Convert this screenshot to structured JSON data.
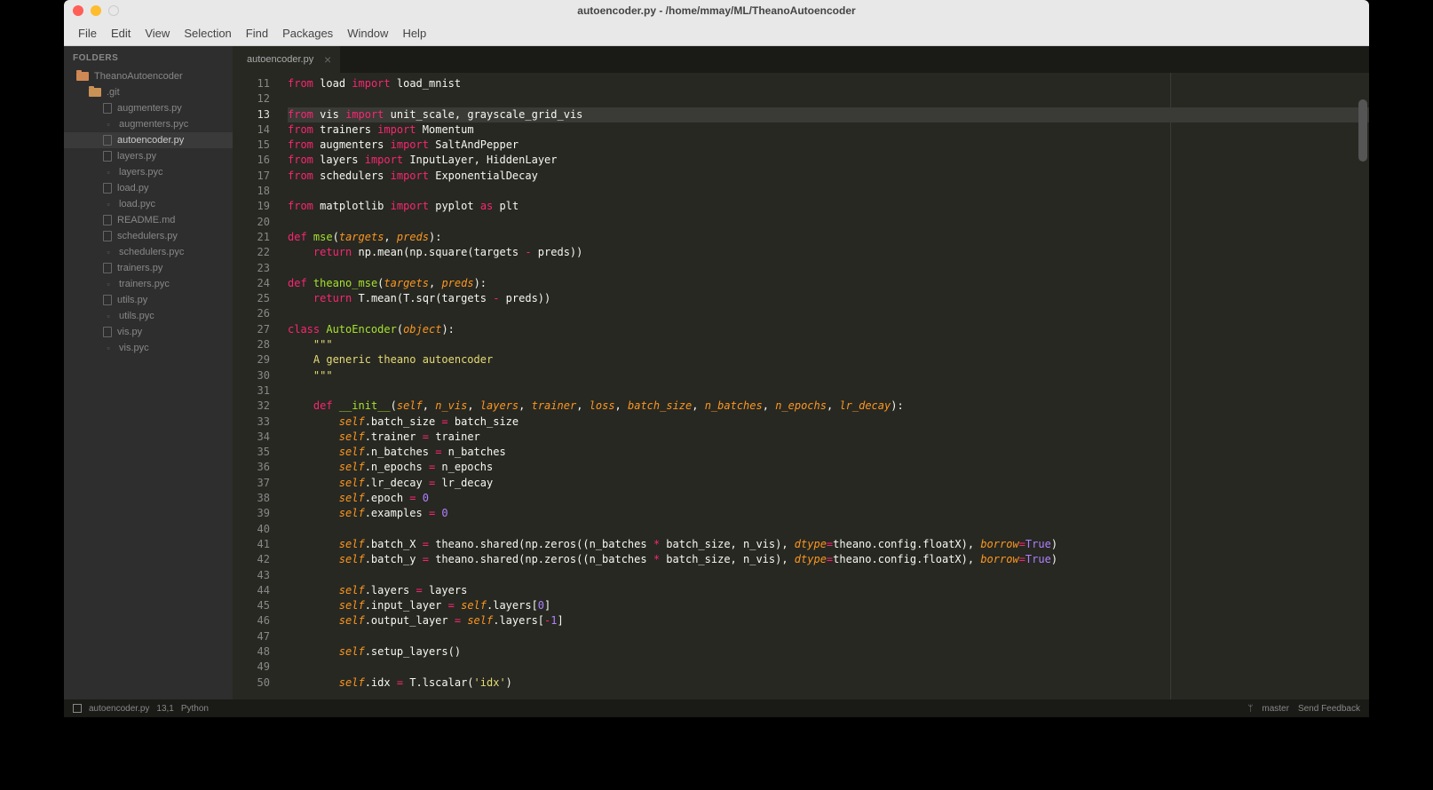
{
  "window": {
    "title": "autoencoder.py - /home/mmay/ML/TheanoAutoencoder"
  },
  "menu": [
    "File",
    "Edit",
    "View",
    "Selection",
    "Find",
    "Packages",
    "Window",
    "Help"
  ],
  "sidebar": {
    "header": "FOLDERS",
    "items": [
      {
        "type": "folder",
        "label": "TheanoAutoencoder",
        "depth": 0,
        "root": true
      },
      {
        "type": "folder",
        "label": ".git",
        "depth": 1
      },
      {
        "type": "py",
        "label": "augmenters.py",
        "depth": 2
      },
      {
        "type": "pyc",
        "label": "augmenters.pyc",
        "depth": 2
      },
      {
        "type": "py",
        "label": "autoencoder.py",
        "depth": 2,
        "active": true
      },
      {
        "type": "py",
        "label": "layers.py",
        "depth": 2
      },
      {
        "type": "pyc",
        "label": "layers.pyc",
        "depth": 2
      },
      {
        "type": "py",
        "label": "load.py",
        "depth": 2
      },
      {
        "type": "pyc",
        "label": "load.pyc",
        "depth": 2
      },
      {
        "type": "py",
        "label": "README.md",
        "depth": 2
      },
      {
        "type": "py",
        "label": "schedulers.py",
        "depth": 2
      },
      {
        "type": "pyc",
        "label": "schedulers.pyc",
        "depth": 2
      },
      {
        "type": "py",
        "label": "trainers.py",
        "depth": 2
      },
      {
        "type": "pyc",
        "label": "trainers.pyc",
        "depth": 2
      },
      {
        "type": "py",
        "label": "utils.py",
        "depth": 2
      },
      {
        "type": "pyc",
        "label": "utils.pyc",
        "depth": 2
      },
      {
        "type": "py",
        "label": "vis.py",
        "depth": 2
      },
      {
        "type": "pyc",
        "label": "vis.pyc",
        "depth": 2
      }
    ]
  },
  "tab": {
    "label": "autoencoder.py"
  },
  "gutter": {
    "start": 11,
    "end": 50,
    "current": 13
  },
  "code": [
    {
      "n": 11,
      "h": "<span class='kw'>from</span> <span class='id'>load</span> <span class='kw'>import</span> <span class='id'>load_mnist</span>"
    },
    {
      "n": 12,
      "h": ""
    },
    {
      "n": 13,
      "hl": true,
      "h": "<span class='kw'>from</span> <span class='id'>vis</span> <span class='kw'>import</span> <span class='id'>unit_scale, grayscale_grid_vis</span>"
    },
    {
      "n": 14,
      "h": "<span class='kw'>from</span> <span class='id'>trainers</span> <span class='kw'>import</span> <span class='id'>Momentum</span>"
    },
    {
      "n": 15,
      "h": "<span class='kw'>from</span> <span class='id'>augmenters</span> <span class='kw'>import</span> <span class='id'>SaltAndPepper</span>"
    },
    {
      "n": 16,
      "h": "<span class='kw'>from</span> <span class='id'>layers</span> <span class='kw'>import</span> <span class='id'>InputLayer, HiddenLayer</span>"
    },
    {
      "n": 17,
      "h": "<span class='kw'>from</span> <span class='id'>schedulers</span> <span class='kw'>import</span> <span class='id'>ExponentialDecay</span>"
    },
    {
      "n": 18,
      "h": ""
    },
    {
      "n": 19,
      "h": "<span class='kw'>from</span> <span class='id'>matplotlib</span> <span class='kw'>import</span> <span class='id'>pyplot</span> <span class='kw'>as</span> <span class='id'>plt</span>"
    },
    {
      "n": 20,
      "h": ""
    },
    {
      "n": 21,
      "h": "<span class='kw'>def</span> <span class='fn'>mse</span>(<span class='arg'>targets</span>, <span class='arg'>preds</span>):"
    },
    {
      "n": 22,
      "h": "    <span class='kw'>return</span> <span class='id'>np.mean(np.square(targets </span><span class='op'>-</span><span class='id'> preds))</span>"
    },
    {
      "n": 23,
      "h": ""
    },
    {
      "n": 24,
      "h": "<span class='kw'>def</span> <span class='fn'>theano_mse</span>(<span class='arg'>targets</span>, <span class='arg'>preds</span>):"
    },
    {
      "n": 25,
      "h": "    <span class='kw'>return</span> <span class='id'>T.mean(T.sqr(targets </span><span class='op'>-</span><span class='id'> preds))</span>"
    },
    {
      "n": 26,
      "h": ""
    },
    {
      "n": 27,
      "h": "<span class='kw'>class</span> <span class='cls'>AutoEncoder</span>(<span class='arg'>object</span>):"
    },
    {
      "n": 28,
      "h": "    <span class='str'>\"\"\"</span>"
    },
    {
      "n": 29,
      "h": "    <span class='str'>A generic theano autoencoder</span>"
    },
    {
      "n": 30,
      "h": "    <span class='str'>\"\"\"</span>"
    },
    {
      "n": 31,
      "h": ""
    },
    {
      "n": 32,
      "h": "    <span class='kw'>def</span> <span class='fn'>__init__</span>(<span class='arg'>self</span>, <span class='arg'>n_vis</span>, <span class='arg'>layers</span>, <span class='arg'>trainer</span>, <span class='arg'>loss</span>, <span class='arg'>batch_size</span>, <span class='arg'>n_batches</span>, <span class='arg'>n_epochs</span>, <span class='arg'>lr_decay</span>):"
    },
    {
      "n": 33,
      "h": "        <span class='self'>self</span>.batch_size <span class='op'>=</span> batch_size"
    },
    {
      "n": 34,
      "h": "        <span class='self'>self</span>.trainer <span class='op'>=</span> trainer"
    },
    {
      "n": 35,
      "h": "        <span class='self'>self</span>.n_batches <span class='op'>=</span> n_batches"
    },
    {
      "n": 36,
      "h": "        <span class='self'>self</span>.n_epochs <span class='op'>=</span> n_epochs"
    },
    {
      "n": 37,
      "h": "        <span class='self'>self</span>.lr_decay <span class='op'>=</span> lr_decay"
    },
    {
      "n": 38,
      "h": "        <span class='self'>self</span>.epoch <span class='op'>=</span> <span class='num'>0</span>"
    },
    {
      "n": 39,
      "h": "        <span class='self'>self</span>.examples <span class='op'>=</span> <span class='num'>0</span>"
    },
    {
      "n": 40,
      "h": ""
    },
    {
      "n": 41,
      "h": "        <span class='self'>self</span>.batch_X <span class='op'>=</span> theano.shared(np.zeros((n_batches <span class='op'>*</span> batch_size, n_vis), <span class='arg'>dtype</span><span class='op'>=</span>theano.config.floatX), <span class='arg'>borrow</span><span class='op'>=</span><span class='bool'>True</span>)"
    },
    {
      "n": 42,
      "h": "        <span class='self'>self</span>.batch_y <span class='op'>=</span> theano.shared(np.zeros((n_batches <span class='op'>*</span> batch_size, n_vis), <span class='arg'>dtype</span><span class='op'>=</span>theano.config.floatX), <span class='arg'>borrow</span><span class='op'>=</span><span class='bool'>True</span>)"
    },
    {
      "n": 43,
      "h": ""
    },
    {
      "n": 44,
      "h": "        <span class='self'>self</span>.layers <span class='op'>=</span> layers"
    },
    {
      "n": 45,
      "h": "        <span class='self'>self</span>.input_layer <span class='op'>=</span> <span class='self'>self</span>.layers[<span class='num'>0</span>]"
    },
    {
      "n": 46,
      "h": "        <span class='self'>self</span>.output_layer <span class='op'>=</span> <span class='self'>self</span>.layers[<span class='op'>-</span><span class='num'>1</span>]"
    },
    {
      "n": 47,
      "h": ""
    },
    {
      "n": 48,
      "h": "        <span class='self'>self</span>.setup_layers()"
    },
    {
      "n": 49,
      "h": ""
    },
    {
      "n": 50,
      "h": "        <span class='self'>self</span>.idx <span class='op'>=</span> T.lscalar(<span class='str'>'idx'</span>)"
    }
  ],
  "status": {
    "file": "autoencoder.py",
    "pos": "13,1",
    "lang": "Python",
    "branch": "master",
    "feedback": "Send Feedback"
  }
}
